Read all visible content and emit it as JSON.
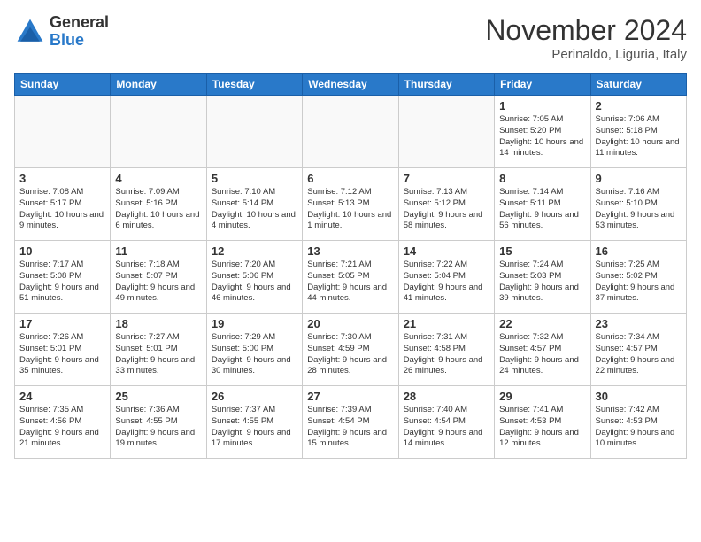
{
  "header": {
    "logo": {
      "general": "General",
      "blue": "Blue"
    },
    "title": "November 2024",
    "location": "Perinaldo, Liguria, Italy"
  },
  "weekdays": [
    "Sunday",
    "Monday",
    "Tuesday",
    "Wednesday",
    "Thursday",
    "Friday",
    "Saturday"
  ],
  "weeks": [
    [
      {
        "day": "",
        "info": ""
      },
      {
        "day": "",
        "info": ""
      },
      {
        "day": "",
        "info": ""
      },
      {
        "day": "",
        "info": ""
      },
      {
        "day": "",
        "info": ""
      },
      {
        "day": "1",
        "info": "Sunrise: 7:05 AM\nSunset: 5:20 PM\nDaylight: 10 hours\nand 14 minutes."
      },
      {
        "day": "2",
        "info": "Sunrise: 7:06 AM\nSunset: 5:18 PM\nDaylight: 10 hours\nand 11 minutes."
      }
    ],
    [
      {
        "day": "3",
        "info": "Sunrise: 7:08 AM\nSunset: 5:17 PM\nDaylight: 10 hours\nand 9 minutes."
      },
      {
        "day": "4",
        "info": "Sunrise: 7:09 AM\nSunset: 5:16 PM\nDaylight: 10 hours\nand 6 minutes."
      },
      {
        "day": "5",
        "info": "Sunrise: 7:10 AM\nSunset: 5:14 PM\nDaylight: 10 hours\nand 4 minutes."
      },
      {
        "day": "6",
        "info": "Sunrise: 7:12 AM\nSunset: 5:13 PM\nDaylight: 10 hours\nand 1 minute."
      },
      {
        "day": "7",
        "info": "Sunrise: 7:13 AM\nSunset: 5:12 PM\nDaylight: 9 hours\nand 58 minutes."
      },
      {
        "day": "8",
        "info": "Sunrise: 7:14 AM\nSunset: 5:11 PM\nDaylight: 9 hours\nand 56 minutes."
      },
      {
        "day": "9",
        "info": "Sunrise: 7:16 AM\nSunset: 5:10 PM\nDaylight: 9 hours\nand 53 minutes."
      }
    ],
    [
      {
        "day": "10",
        "info": "Sunrise: 7:17 AM\nSunset: 5:08 PM\nDaylight: 9 hours\nand 51 minutes."
      },
      {
        "day": "11",
        "info": "Sunrise: 7:18 AM\nSunset: 5:07 PM\nDaylight: 9 hours\nand 49 minutes."
      },
      {
        "day": "12",
        "info": "Sunrise: 7:20 AM\nSunset: 5:06 PM\nDaylight: 9 hours\nand 46 minutes."
      },
      {
        "day": "13",
        "info": "Sunrise: 7:21 AM\nSunset: 5:05 PM\nDaylight: 9 hours\nand 44 minutes."
      },
      {
        "day": "14",
        "info": "Sunrise: 7:22 AM\nSunset: 5:04 PM\nDaylight: 9 hours\nand 41 minutes."
      },
      {
        "day": "15",
        "info": "Sunrise: 7:24 AM\nSunset: 5:03 PM\nDaylight: 9 hours\nand 39 minutes."
      },
      {
        "day": "16",
        "info": "Sunrise: 7:25 AM\nSunset: 5:02 PM\nDaylight: 9 hours\nand 37 minutes."
      }
    ],
    [
      {
        "day": "17",
        "info": "Sunrise: 7:26 AM\nSunset: 5:01 PM\nDaylight: 9 hours\nand 35 minutes."
      },
      {
        "day": "18",
        "info": "Sunrise: 7:27 AM\nSunset: 5:01 PM\nDaylight: 9 hours\nand 33 minutes."
      },
      {
        "day": "19",
        "info": "Sunrise: 7:29 AM\nSunset: 5:00 PM\nDaylight: 9 hours\nand 30 minutes."
      },
      {
        "day": "20",
        "info": "Sunrise: 7:30 AM\nSunset: 4:59 PM\nDaylight: 9 hours\nand 28 minutes."
      },
      {
        "day": "21",
        "info": "Sunrise: 7:31 AM\nSunset: 4:58 PM\nDaylight: 9 hours\nand 26 minutes."
      },
      {
        "day": "22",
        "info": "Sunrise: 7:32 AM\nSunset: 4:57 PM\nDaylight: 9 hours\nand 24 minutes."
      },
      {
        "day": "23",
        "info": "Sunrise: 7:34 AM\nSunset: 4:57 PM\nDaylight: 9 hours\nand 22 minutes."
      }
    ],
    [
      {
        "day": "24",
        "info": "Sunrise: 7:35 AM\nSunset: 4:56 PM\nDaylight: 9 hours\nand 21 minutes."
      },
      {
        "day": "25",
        "info": "Sunrise: 7:36 AM\nSunset: 4:55 PM\nDaylight: 9 hours\nand 19 minutes."
      },
      {
        "day": "26",
        "info": "Sunrise: 7:37 AM\nSunset: 4:55 PM\nDaylight: 9 hours\nand 17 minutes."
      },
      {
        "day": "27",
        "info": "Sunrise: 7:39 AM\nSunset: 4:54 PM\nDaylight: 9 hours\nand 15 minutes."
      },
      {
        "day": "28",
        "info": "Sunrise: 7:40 AM\nSunset: 4:54 PM\nDaylight: 9 hours\nand 14 minutes."
      },
      {
        "day": "29",
        "info": "Sunrise: 7:41 AM\nSunset: 4:53 PM\nDaylight: 9 hours\nand 12 minutes."
      },
      {
        "day": "30",
        "info": "Sunrise: 7:42 AM\nSunset: 4:53 PM\nDaylight: 9 hours\nand 10 minutes."
      }
    ]
  ]
}
